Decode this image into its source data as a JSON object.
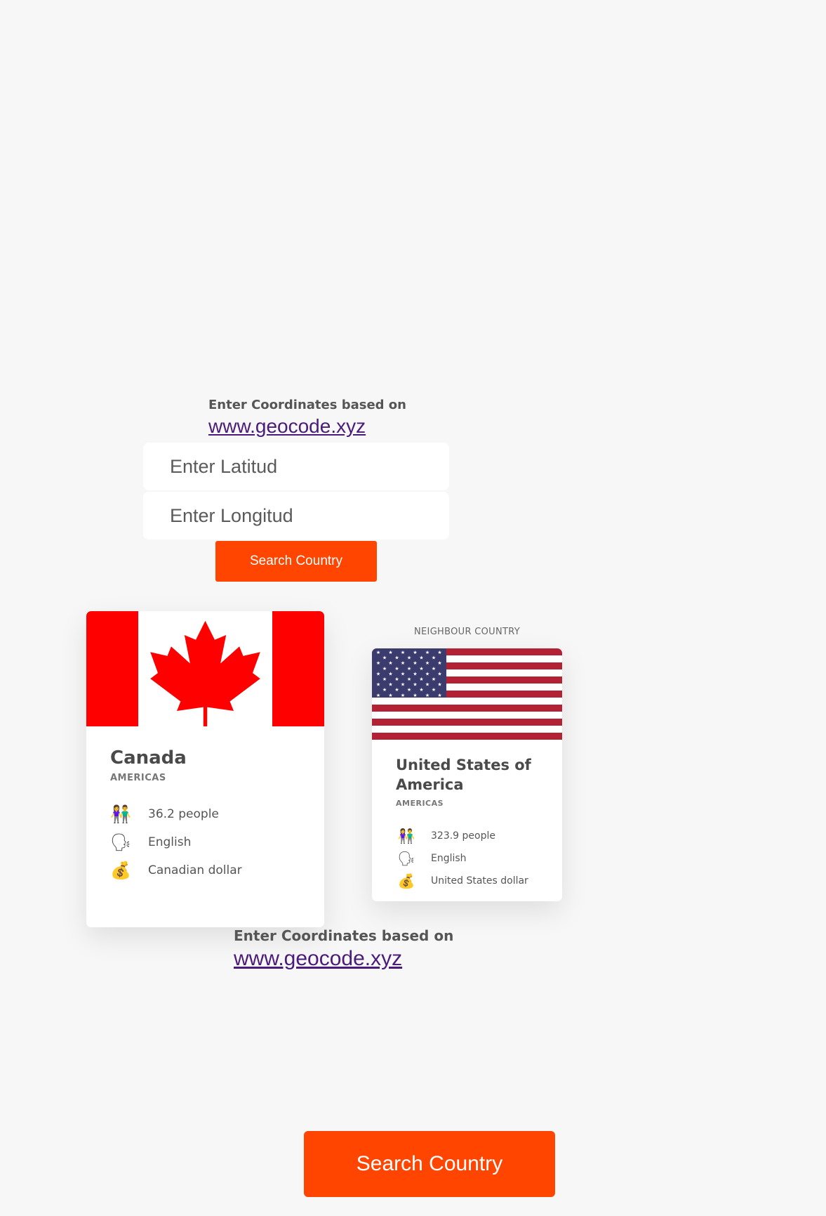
{
  "intro_top": {
    "text": "Enter Coordinates based on",
    "link": "www.geocode.xyz"
  },
  "form": {
    "lat_placeholder": "Enter Latitud",
    "lng_placeholder": "Enter Longitud",
    "search_label": "Search Country"
  },
  "country": {
    "name": "Canada",
    "region": "AMERICAS",
    "population": "36.2 people",
    "language": "English",
    "currency": "Canadian dollar",
    "flag_colors": [
      "#ff0000",
      "#ffffff"
    ]
  },
  "neighbour": {
    "label": "NEIGHBOUR COUNTRY",
    "name": "United States of America",
    "region": "AMERICAS",
    "population": "323.9 people",
    "language": "English",
    "currency": "United States dollar",
    "flag_colors": [
      "#b22234",
      "#ffffff",
      "#3c3b6e"
    ]
  },
  "icons": {
    "population": "people-icon",
    "language": "speaking-head-icon",
    "currency": "money-bag-icon"
  },
  "intro_bottom": {
    "text": "Enter Coordinates based on",
    "link": "www.geocode.xyz"
  },
  "bottom_button": {
    "label": "Search Country"
  },
  "colors": {
    "accent": "#ff4500",
    "link": "#4b1b7a",
    "background": "#f7f7f7"
  }
}
